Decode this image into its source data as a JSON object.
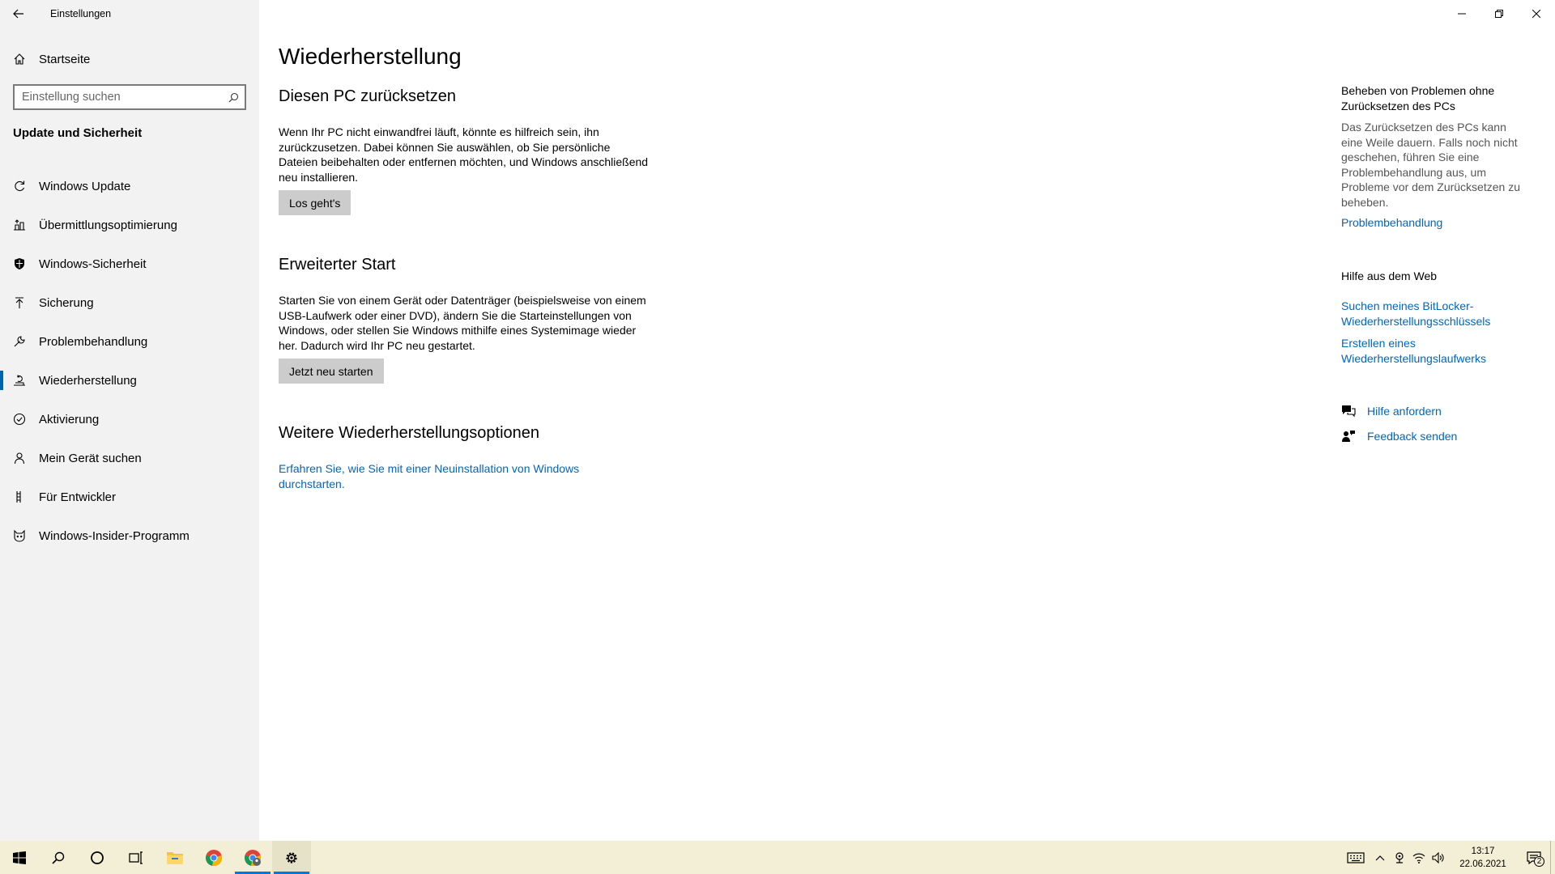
{
  "window": {
    "title": "Einstellungen"
  },
  "sidebar": {
    "home_label": "Startseite",
    "search_placeholder": "Einstellung suchen",
    "section_title": "Update und Sicherheit",
    "items": [
      {
        "label": "Windows Update",
        "icon": "refresh-icon",
        "active": false
      },
      {
        "label": "Übermittlungsoptimierung",
        "icon": "delivery-icon",
        "active": false
      },
      {
        "label": "Windows-Sicherheit",
        "icon": "shield-icon",
        "active": false
      },
      {
        "label": "Sicherung",
        "icon": "upload-arrow-icon",
        "active": false
      },
      {
        "label": "Problembehandlung",
        "icon": "wrench-icon",
        "active": false
      },
      {
        "label": "Wiederherstellung",
        "icon": "recovery-icon",
        "active": true
      },
      {
        "label": "Aktivierung",
        "icon": "check-circle-icon",
        "active": false
      },
      {
        "label": "Mein Gerät suchen",
        "icon": "person-icon",
        "active": false
      },
      {
        "label": "Für Entwickler",
        "icon": "developer-icon",
        "active": false
      },
      {
        "label": "Windows-Insider-Programm",
        "icon": "insider-cat-icon",
        "active": false
      }
    ],
    "accent_color": "#0063b1"
  },
  "main": {
    "title": "Wiederherstellung",
    "reset": {
      "heading": "Diesen PC zurücksetzen",
      "text": "Wenn Ihr PC nicht einwandfrei läuft, könnte es hilfreich sein, ihn zurückzusetzen. Dabei können Sie auswählen, ob Sie persönliche Dateien beibehalten oder entfernen möchten, und Windows anschließend neu installieren.",
      "button": "Los geht's"
    },
    "advanced": {
      "heading": "Erweiterter Start",
      "text": "Starten Sie von einem Gerät oder Datenträger (beispielsweise von einem USB-Laufwerk oder einer DVD), ändern Sie die Starteinstellungen von Windows, oder stellen Sie Windows mithilfe eines Systemimage wieder her. Dadurch wird Ihr PC neu gestartet.",
      "button": "Jetzt neu starten"
    },
    "more": {
      "heading": "Weitere Wiederherstellungsoptionen",
      "link": "Erfahren Sie, wie Sie mit einer Neuinstallation von Windows durchstarten."
    }
  },
  "aside": {
    "troubleshoot_heading": "Beheben von Problemen ohne Zurücksetzen des PCs",
    "troubleshoot_text": "Das Zurücksetzen des PCs kann eine Weile dauern. Falls noch nicht geschehen, führen Sie eine Problembehandlung aus, um Probleme vor dem Zurücksetzen zu beheben.",
    "troubleshoot_link": "Problembehandlung",
    "web_help_heading": "Hilfe aus dem Web",
    "web_links": [
      "Suchen meines BitLocker-Wiederherstellungsschlüssels",
      "Erstellen eines Wiederherstellungslaufwerks"
    ],
    "get_help": "Hilfe anfordern",
    "feedback": "Feedback senden",
    "link_color": "#0067b8"
  },
  "taskbar": {
    "time": "13:17",
    "date": "22.06.2021",
    "notification_count": "2",
    "background": "#f3efd6"
  }
}
